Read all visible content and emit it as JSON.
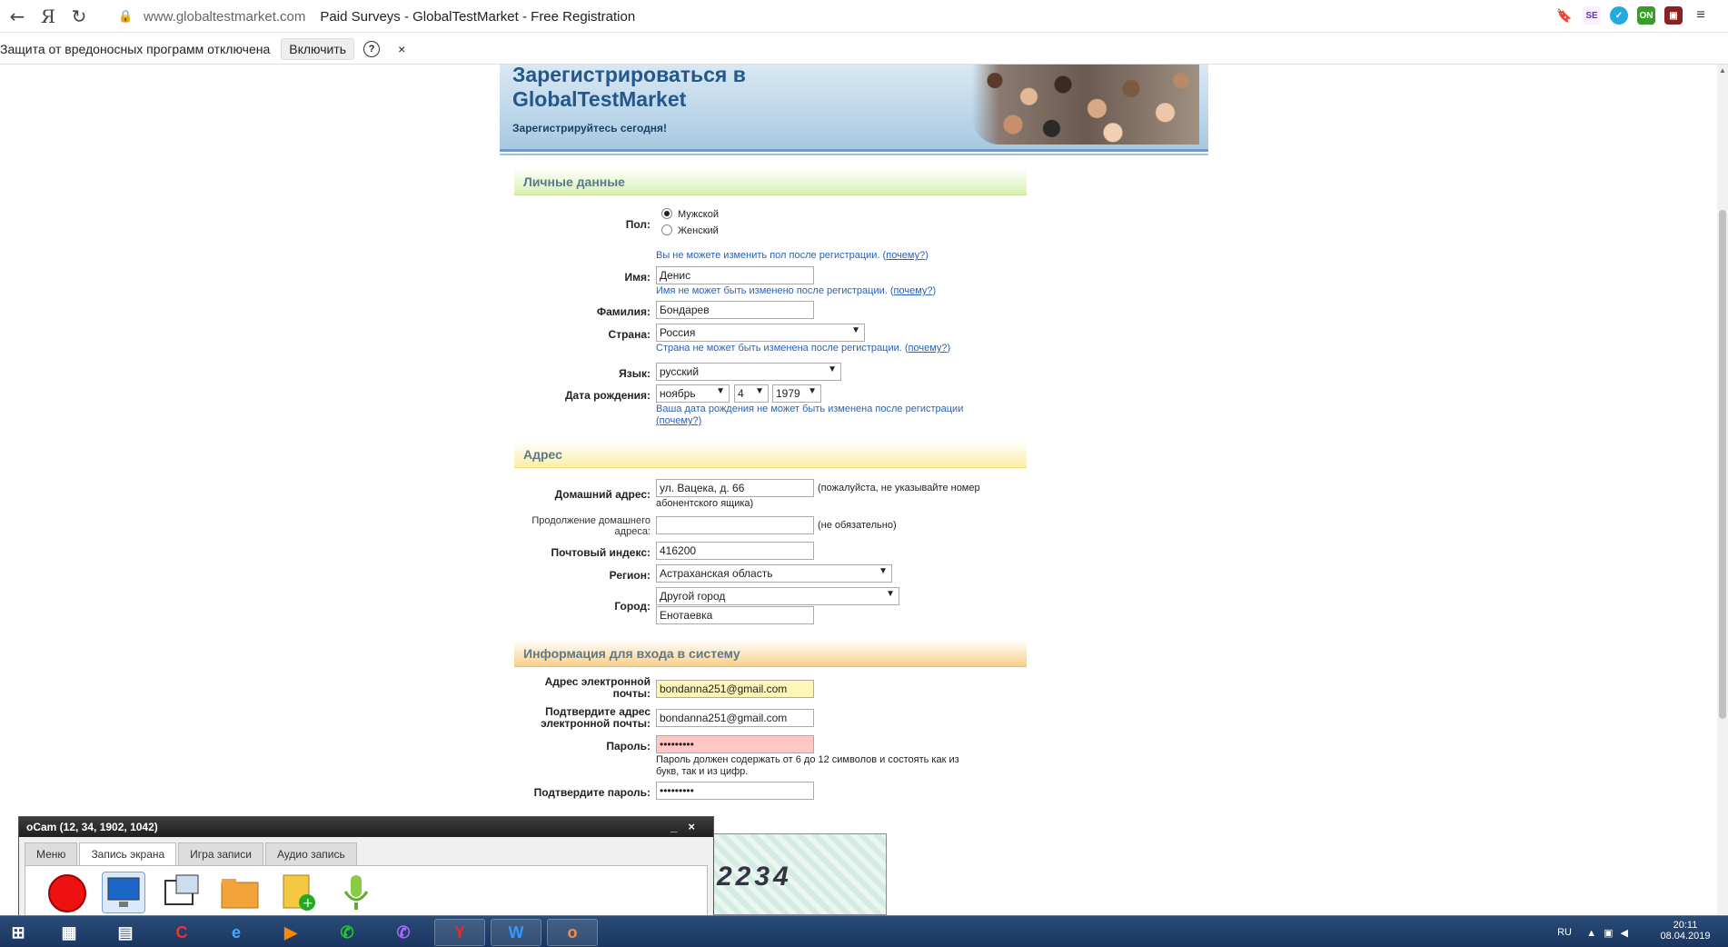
{
  "browser": {
    "back_glyph": "←",
    "yandex_logo": "Я",
    "reload_glyph": "↻",
    "domain": "www.globaltestmarket.com",
    "tab_title": "Paid Surveys - GlobalTestMarket - Free Registration",
    "bookmark_glyph": "🔖"
  },
  "infobar": {
    "message": "Защита от вредоносных программ отключена",
    "enable_label": "Включить",
    "help_label": "?",
    "close_label": "×"
  },
  "banner": {
    "title": "Зарегистрироваться в GlobalTestMarket",
    "subtitle": "Зарегистрируйтесь сегодня!"
  },
  "personal": {
    "heading": "Личные данные",
    "gender_label": "Пол:",
    "gender_male": "Мужской",
    "gender_female": "Женский",
    "gender_note": "Вы не можете изменить пол после регистрации. (",
    "why": "почему?",
    "close_paren": ")",
    "first_name_label": "Имя:",
    "first_name_value": "Денис",
    "first_name_note": "Имя не может быть изменено после регистрации. (",
    "last_name_label": "Фамилия:",
    "last_name_value": "Бондарев",
    "country_label": "Страна:",
    "country_value": "Россия",
    "country_note": "Страна не может быть изменена после регистрации. (",
    "language_label": "Язык:",
    "language_value": "русский",
    "dob_label": "Дата рождения:",
    "dob_month": "ноябрь",
    "dob_day": "4",
    "dob_year": "1979",
    "dob_note": "Ваша дата рождения не может быть изменена после регистрации",
    "dob_why": "(почему?)"
  },
  "address": {
    "heading": "Адрес",
    "home_label": "Домашний адрес:",
    "home_value": "ул. Вацека, д. 66",
    "home_note_1": "(пожалуйста, не указывайте номер",
    "home_note_2": "абонентского ящика)",
    "cont_label_1": "Продолжение домашнего",
    "cont_label_2": "адреса:",
    "cont_value": "",
    "cont_note": "(не обязательно)",
    "zip_label": "Почтовый индекс:",
    "zip_value": "416200",
    "region_label": "Регион:",
    "region_value": "Астраханская область",
    "city_label": "Город:",
    "city_select": "Другой город",
    "city_value": "Енотаевка"
  },
  "login": {
    "heading": "Информация для входа в систему",
    "email_label_1": "Адрес электронной",
    "email_label_2": "почты:",
    "email_value": "bondanna251@gmail.com",
    "confirm_email_label_1": "Подтвердите адрес",
    "confirm_email_label_2": "электронной почты:",
    "confirm_email_value": "bondanna251@gmail.com",
    "password_label": "Пароль:",
    "password_value": "•••••••••",
    "password_note_1": "Пароль должен содержать от 6 до 12 символов и состоять как из",
    "password_note_2": "букв, так и из цифр.",
    "confirm_password_label": "Подтвердите пароль:",
    "confirm_password_value": "•••••••••"
  },
  "captcha": {
    "text": "2234"
  },
  "ocam": {
    "title": "oCam (12, 34, 1902, 1042)",
    "controls": "_×",
    "tabs": [
      "Меню",
      "Запись экрана",
      "Игра записи",
      "Аудио запись"
    ]
  },
  "tray": {
    "lang": "RU",
    "time": "20:11",
    "date": "08.04.2019"
  }
}
